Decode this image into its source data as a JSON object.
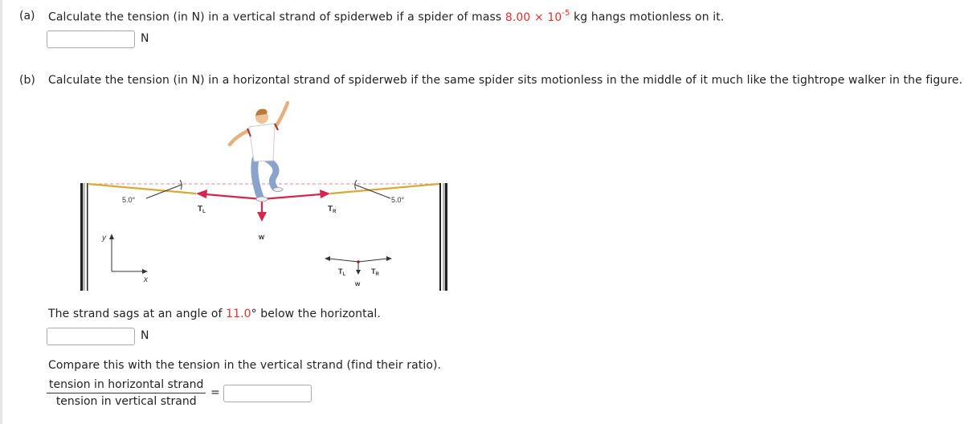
{
  "part_a": {
    "label": "(a)",
    "text_before": "Calculate the tension (in N) in a vertical strand of spiderweb if a spider of mass ",
    "mass_value": "8.00 × 10",
    "mass_exponent": "-5",
    "text_after": " kg hangs motionless on it.",
    "answer_value": "",
    "unit": "N"
  },
  "part_b": {
    "label": "(b)",
    "text": "Calculate the tension (in N) in a horizontal strand of spiderweb if the same spider sits motionless in the middle of it much like the tightrope walker in the figure.",
    "sag_text_before": "The strand sags at an angle of ",
    "sag_angle": "11.0",
    "sag_text_after": "° below the horizontal.",
    "answer_value": "",
    "unit": "N",
    "compare_text": "Compare this with the tension in the vertical strand (find their ratio).",
    "ratio_numerator": "tension in horizontal strand",
    "ratio_denominator": "tension in vertical strand",
    "equals": "=",
    "ratio_value": ""
  },
  "figure": {
    "angle_left": "5.0°",
    "angle_right": "5.0°",
    "tension_left": "T",
    "tension_left_sub": "L",
    "tension_right": "T",
    "tension_right_sub": "R",
    "weight": "w",
    "axis_y": "y",
    "axis_x": "x",
    "fbd_tension_left": "T",
    "fbd_tension_left_sub": "L",
    "fbd_tension_right": "T",
    "fbd_tension_right_sub": "R",
    "fbd_weight": "w",
    "colors": {
      "rope": "#d9a934",
      "force": "#d6254f",
      "dashed": "#e08a8a",
      "post": "#222222"
    }
  }
}
